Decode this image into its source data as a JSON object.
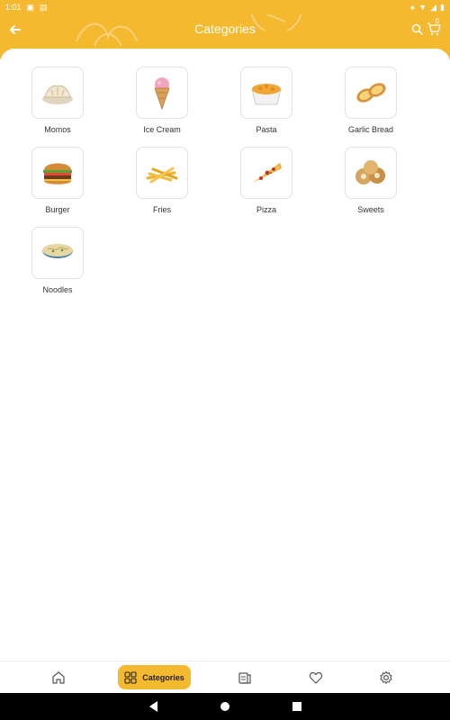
{
  "status_bar": {
    "time": "1:01"
  },
  "header": {
    "title": "Categories",
    "cart_count": "0"
  },
  "categories": [
    {
      "label": "Momos",
      "icon": "momos-icon"
    },
    {
      "label": "Ice Cream",
      "icon": "ice-cream-icon"
    },
    {
      "label": "Pasta",
      "icon": "pasta-icon"
    },
    {
      "label": "Garlic Bread",
      "icon": "garlic-bread-icon"
    },
    {
      "label": "Burger",
      "icon": "burger-icon"
    },
    {
      "label": "Fries",
      "icon": "fries-icon"
    },
    {
      "label": "Pizza",
      "icon": "pizza-icon"
    },
    {
      "label": "Sweets",
      "icon": "sweets-icon"
    },
    {
      "label": "Noodles",
      "icon": "noodles-icon"
    }
  ],
  "bottom_nav": {
    "active_label": "Categories",
    "items": [
      "home-icon",
      "categories-icon",
      "orders-icon",
      "favorites-icon",
      "settings-icon"
    ]
  },
  "colors": {
    "accent": "#f4b92f",
    "text": "#333333"
  }
}
